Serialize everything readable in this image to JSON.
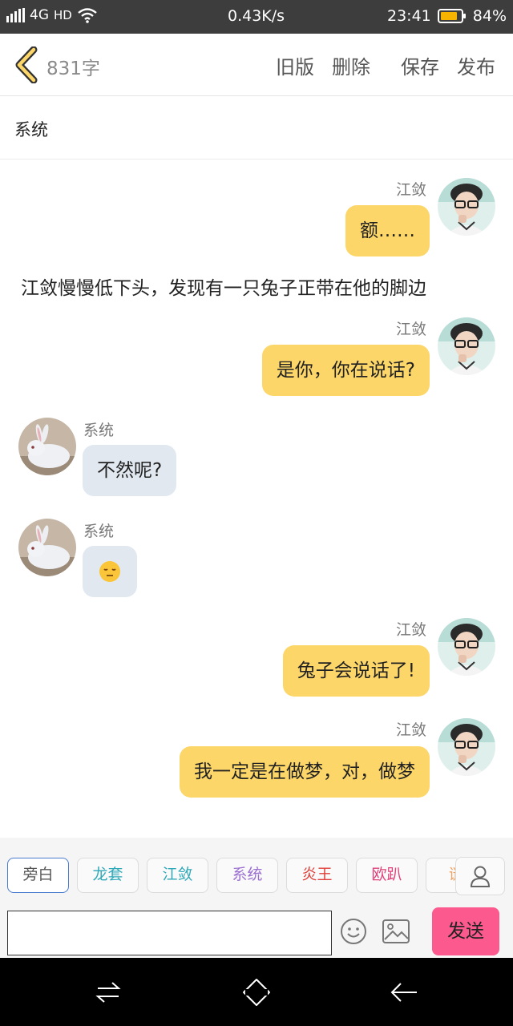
{
  "status_bar": {
    "network": "4G",
    "hd": "HD",
    "speed": "0.43K/s",
    "time": "23:41",
    "battery": "84%",
    "battery_level": 0.84
  },
  "toolbar": {
    "word_count": "831字",
    "old_version": "旧版",
    "delete": "删除",
    "save": "保存",
    "publish": "发布"
  },
  "chapter": {
    "title": "系统"
  },
  "messages": [
    {
      "type": "right",
      "name": "江敛",
      "text": "额……"
    },
    {
      "type": "narration",
      "text": "江敛慢慢低下头，发现有一只兔子正带在他的脚边"
    },
    {
      "type": "right",
      "name": "江敛",
      "text": "是你，你在说话?"
    },
    {
      "type": "left",
      "name": "系统",
      "text": "不然呢?"
    },
    {
      "type": "left",
      "name": "系统",
      "emoji": "expressionless-face"
    },
    {
      "type": "right",
      "name": "江敛",
      "text": "兔子会说话了!"
    },
    {
      "type": "right",
      "name": "江敛",
      "text": "我一定是在做梦，对，做梦"
    }
  ],
  "role_chips": [
    {
      "label": "旁白",
      "color": "#555555",
      "active": true
    },
    {
      "label": "龙套",
      "color": "#2fa8b8"
    },
    {
      "label": "江敛",
      "color": "#2fa8b8"
    },
    {
      "label": "系统",
      "color": "#9b6fd0"
    },
    {
      "label": "炎王",
      "color": "#e0403a"
    },
    {
      "label": "欧趴",
      "color": "#e0407a"
    },
    {
      "label": "谜",
      "color": "#f0a060"
    }
  ],
  "input": {
    "value": "",
    "send": "发送"
  },
  "colors": {
    "me_bubble": "#fcd669",
    "other_bubble": "#e1e8f0",
    "send_button": "#fc5a8e",
    "status_bar": "#3d3d3d"
  }
}
